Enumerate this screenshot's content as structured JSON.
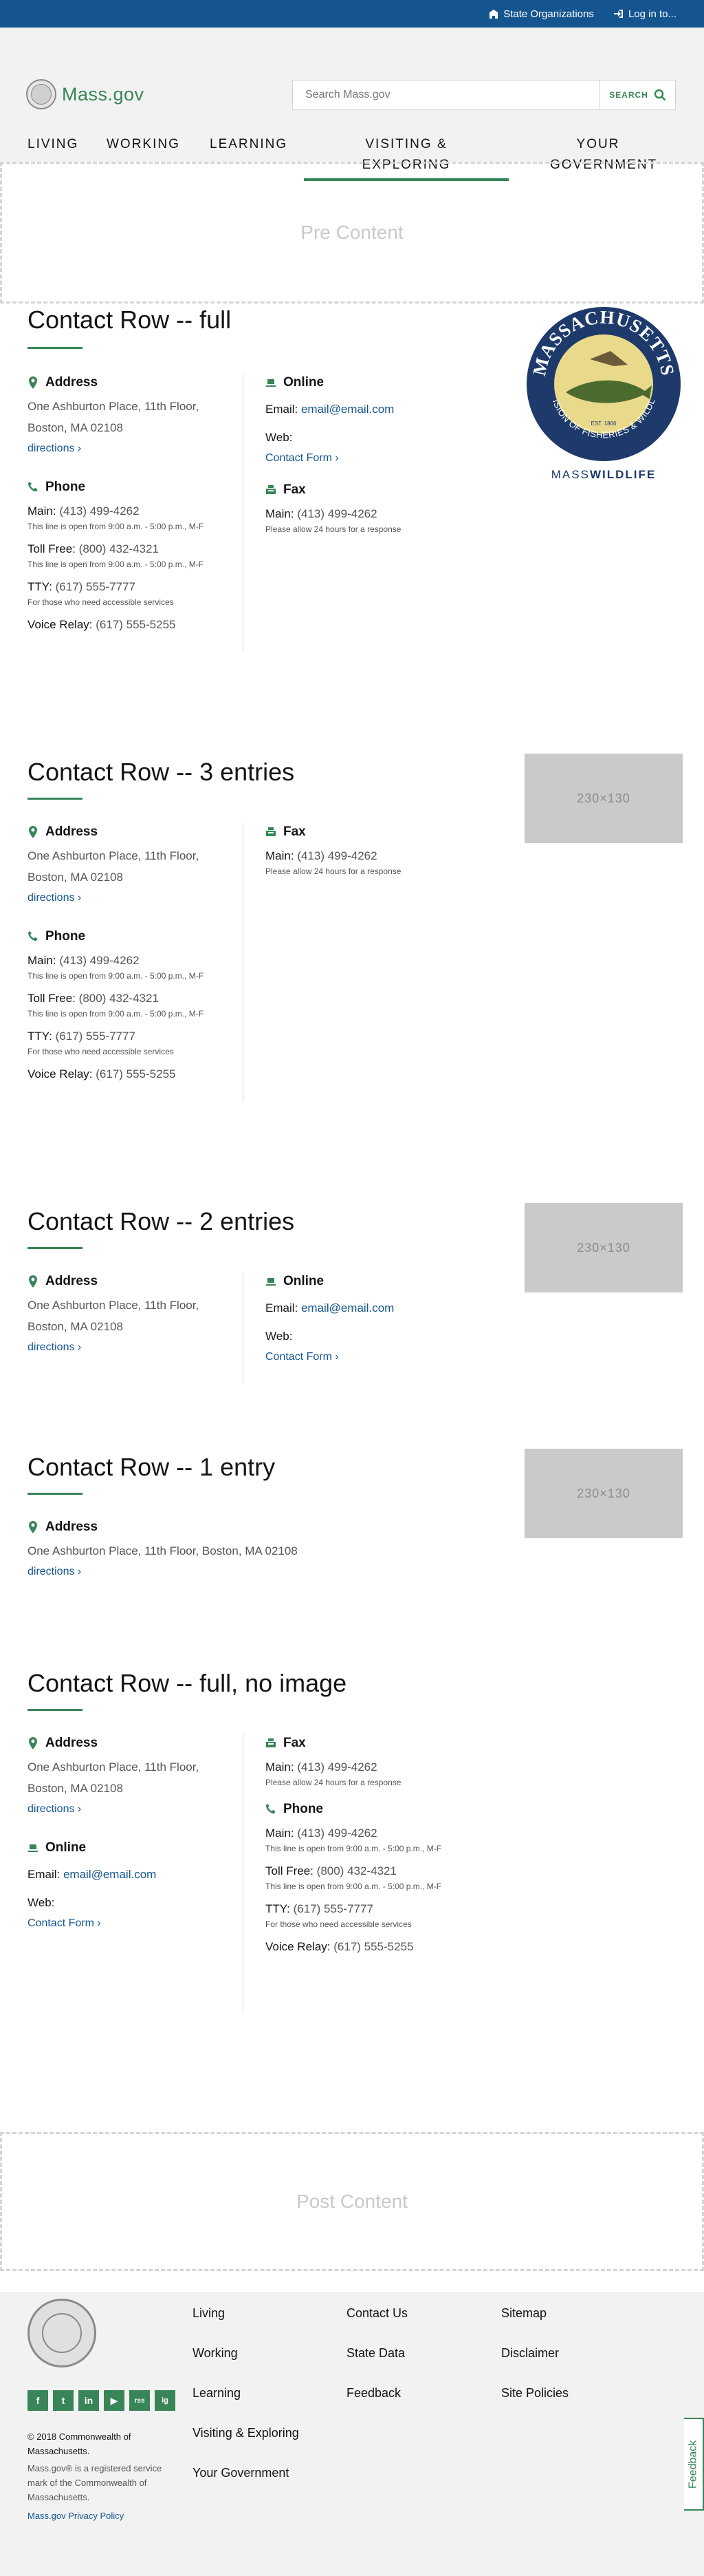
{
  "utility": {
    "state_orgs": "State Organizations",
    "login": "Log in to..."
  },
  "header": {
    "logo_text": "Mass.gov",
    "search_placeholder": "Search Mass.gov",
    "search_button": "SEARCH",
    "nav": [
      "Living",
      "Working",
      "Learning",
      "Visiting & Exploring",
      "Your Government"
    ]
  },
  "pre_content": "Pre Content",
  "post_content": "Post Content",
  "labels": {
    "address": "Address",
    "online": "Online",
    "phone": "Phone",
    "fax": "Fax",
    "directions": "directions ›",
    "email_label": "Email:",
    "email_value": "email@email.com",
    "web_label": "Web:",
    "contact_form": "Contact Form ›",
    "main": "Main:",
    "main_number": "(413) 499-4262",
    "hours_note": "This line is open from 9:00 a.m. - 5:00 p.m., M-F",
    "toll_free": "Toll Free:",
    "toll_free_number": "(800) 432-4321",
    "tty": "TTY:",
    "tty_number": "(617) 555-7777",
    "tty_note": "For those who need accessible services",
    "voice_relay": "Voice Relay:",
    "voice_relay_number": "(617) 555-5255",
    "fax_main_number": "(413) 499-4262",
    "fax_note": "Please allow 24 hours for a response",
    "addr_line1": "One Ashburton Place, 11th Floor,",
    "addr_line2": "Boston, MA 02108",
    "addr_full": "One Ashburton Place, 11th Floor, Boston, MA 02108",
    "img_placeholder": "230×130"
  },
  "rows": {
    "full": "Contact Row -- full",
    "three": "Contact Row -- 3 entries",
    "two": "Contact Row -- 2 entries",
    "one": "Contact Row -- 1 entry",
    "noimg": "Contact Row -- full, no image"
  },
  "badge": {
    "top": "MASSACHUSETTS",
    "bottom": "DIVISION OF FISHERIES & WILDLIFE",
    "est": "EST. 1866",
    "mass": "MASS",
    "wildlife": "WILDLIFE"
  },
  "footer": {
    "col1": [
      "Living",
      "Working",
      "Learning",
      "Visiting & Exploring",
      "Your Government"
    ],
    "col2": [
      "Contact Us",
      "State Data",
      "Feedback"
    ],
    "col3": [
      "Sitemap",
      "Disclaimer",
      "Site Policies"
    ],
    "social": [
      "f",
      "t",
      "in",
      "▶",
      "rss",
      "ig"
    ],
    "copyright": "© 2018 Commonwealth of Massachusetts.",
    "trademark": "Mass.gov® is a registered service mark of the Commonwealth of Massachusetts.",
    "privacy": "Mass.gov Privacy Policy",
    "feedback_tab": "Feedback"
  }
}
